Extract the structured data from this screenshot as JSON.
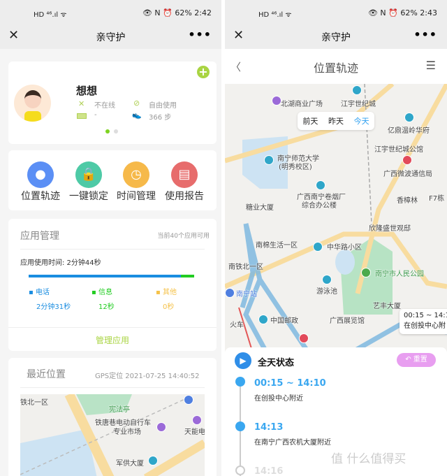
{
  "left": {
    "status": {
      "icons": "HD ⁴⁶.ıl ᯤ",
      "right": "👁 N ⏰ 62%",
      "time": "2:42"
    },
    "nav": {
      "close": "✕",
      "title": "亲守护",
      "more": "•••"
    },
    "profile": {
      "name": "想想",
      "status": "不在线",
      "mode": "自由使用",
      "battery": "-",
      "steps": "366 步",
      "add_icon": "plus-icon"
    },
    "features": [
      {
        "label": "位置轨迹",
        "color": "#5b8ff5"
      },
      {
        "label": "一键锁定",
        "color": "#4ecaa6"
      },
      {
        "label": "时间管理",
        "color": "#f6b94a"
      },
      {
        "label": "使用报告",
        "color": "#e76c6c"
      }
    ],
    "apps": {
      "title": "应用管理",
      "available": "当前40个应用可用",
      "usage_label": "应用使用时间: 2分钟44秒",
      "categories": [
        {
          "name": "电话",
          "time": "2分钟31秒",
          "color": "#1a8de0",
          "share": 92
        },
        {
          "name": "信息",
          "time": "12秒",
          "color": "#22cc22",
          "share": 8
        },
        {
          "name": "其他",
          "time": "0秒",
          "color": "#f5c24a",
          "share": 0
        }
      ],
      "manage_button": "管理应用"
    },
    "recent": {
      "title": "最近位置",
      "info": "GPS定位  2021-07-25 14:40:52",
      "map_labels": [
        "铁北一区",
        "宪法亭",
        "铁唐巷电动自行车",
        "专业市场",
        "天能电池",
        "军供大厦"
      ]
    }
  },
  "right": {
    "status": {
      "icons": "HD ⁴⁶.ıl ᯤ",
      "right": "👁 N ⏰ 62%",
      "time": "2:43"
    },
    "nav": {
      "close": "✕",
      "title": "亲守护",
      "more": "•••"
    },
    "header": {
      "back": "〈",
      "title": "位置轨迹",
      "menu": "☰"
    },
    "day_tabs": [
      "前天",
      "昨天",
      "今天"
    ],
    "selected_day": "今天",
    "map_labels": [
      "北湖商业广场",
      "江宇世纪城",
      "亿鼎温岭华府",
      "江宇世纪城公馆",
      "南宁师范大学",
      "(明秀校区)",
      "广西微波通信局",
      "广西南宁卷烟厂",
      "综合办公楼",
      "香樟林",
      "F7栋",
      "糖业大厦",
      "欣隆盛世观邸",
      "南棉生活一区",
      "中华路小区",
      "南铁北一区",
      "南宁市人民公园",
      "游泳池",
      "南宁站",
      "火车",
      "中国邮政",
      "艺丰大厦",
      "广西展览馆"
    ],
    "map_popup": {
      "time": "00:15 ~ 14:1",
      "place": "在创投中心附"
    },
    "timeline": {
      "title": "全天状态",
      "reset": "重置",
      "entries": [
        {
          "time": "00:15 ~ 14:10",
          "place": "在创投中心附近"
        },
        {
          "time": "14:13",
          "place": "在南宁广西农机大厦附近"
        },
        {
          "time": "14:16",
          "place": ""
        }
      ]
    },
    "watermark": "值 什么值得买"
  }
}
